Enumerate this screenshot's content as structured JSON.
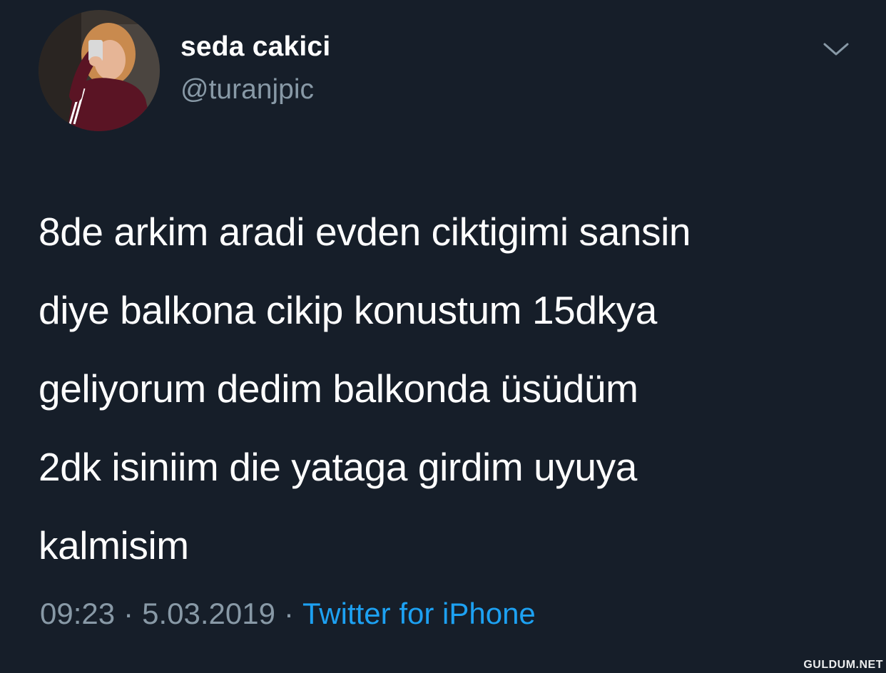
{
  "tweet": {
    "display_name": "seda cakici",
    "handle": "@turanjpic",
    "text": "8de arkim aradi evden ciktigimi sansin\ndiye balkona cikip konustum 15dkya\ngeliyorum dedim balkonda üsüdüm\n2dk isiniim die yataga girdim uyuya\nkalmisim",
    "time": "09:23",
    "date": "5.03.2019",
    "separator": "·",
    "source": "Twitter for iPhone"
  },
  "icons": {
    "avatar": "profile-photo",
    "menu": "chevron-down-icon"
  },
  "watermark": "GULDUM.NET",
  "colors": {
    "background": "#161e29",
    "text_primary": "#ffffff",
    "text_secondary": "#8899a6",
    "link": "#1da1f2"
  }
}
